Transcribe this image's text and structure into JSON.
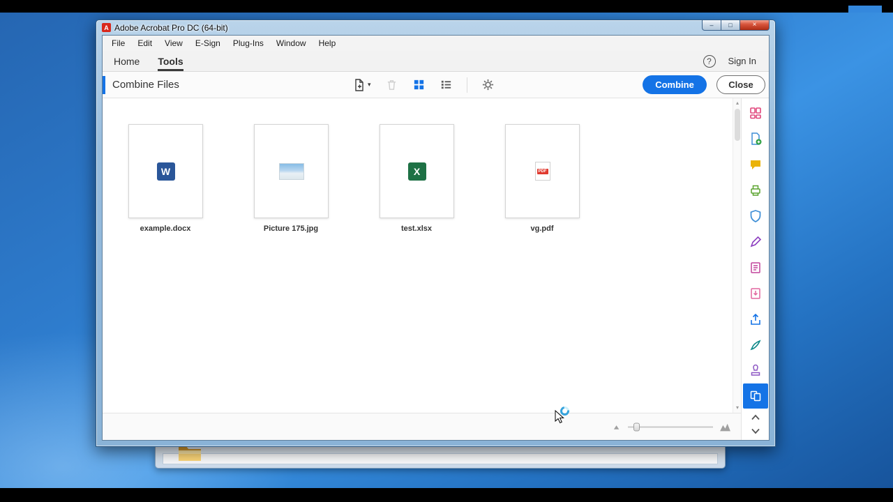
{
  "titlebar": {
    "app_icon_letter": "A",
    "title": "Adobe Acrobat Pro DC (64-bit)",
    "minimize": "–",
    "maximize": "□",
    "close": "×"
  },
  "menu": {
    "items": [
      "File",
      "Edit",
      "View",
      "E-Sign",
      "Plug-Ins",
      "Window",
      "Help"
    ]
  },
  "nav": {
    "tabs": [
      {
        "label": "Home"
      },
      {
        "label": "Tools"
      }
    ],
    "active_tab": "Tools",
    "help": "?",
    "sign_in": "Sign In"
  },
  "toolbar": {
    "title": "Combine Files",
    "combine": "Combine",
    "close": "Close",
    "icons": [
      "add-files",
      "delete",
      "grid-view",
      "list-view",
      "settings"
    ],
    "active_view": "grid"
  },
  "ui_glyphs": {
    "caret_down": "▾",
    "scroll_up": "▴",
    "scroll_down": "▾"
  },
  "content": {
    "files": [
      {
        "name": "example.docx",
        "type": "word",
        "icon_letter": "W"
      },
      {
        "name": "Picture 175.jpg",
        "type": "image",
        "icon_letter": ""
      },
      {
        "name": "test.xlsx",
        "type": "excel",
        "icon_letter": "X"
      },
      {
        "name": "vg.pdf",
        "type": "pdf",
        "icon_letter": "PDF"
      }
    ]
  },
  "right_rail": {
    "icons": [
      "organize-pages",
      "create-pdf",
      "comment",
      "scan-ocr",
      "protect",
      "fill-sign",
      "edit-pdf",
      "export-pdf",
      "share",
      "request-signatures",
      "stamp",
      "combine-files"
    ],
    "active": "combine-files"
  },
  "colors": {
    "accent": "#1473E6",
    "close_button_red": "#B02D15",
    "desktop_blue": "#2E7CCD",
    "active_tool_bg": "#1473E6"
  }
}
